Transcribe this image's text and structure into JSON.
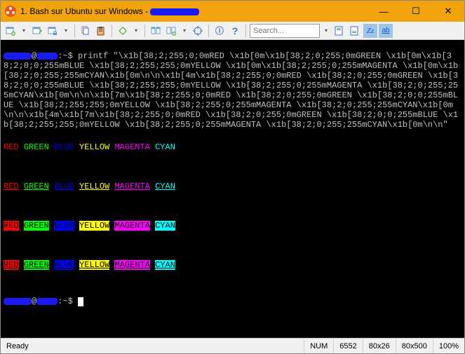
{
  "titlebar": {
    "title_prefix": "1. Bash sur Ubuntu sur Windows - "
  },
  "window_controls": {
    "minimize": "—",
    "maximize": "☐",
    "close": "✕"
  },
  "toolbar": {
    "search_placeholder": "Search..."
  },
  "icons": {
    "info": "ⓘ",
    "help": "?",
    "zz": "Zz",
    "ab": "ab"
  },
  "terminal": {
    "prompt_sep": ":~$ ",
    "command": "printf \"\\x1b[38;2;255;0;0mRED \\x1b[0m\\x1b[38;2;0;255;0mGREEN \\x1b[0m\\x1b[38;2;0;0;255mBLUE \\x1b[38;2;255;255;0mYELLOW \\x1b[0m\\x1b[38;2;255;0;255mMAGENTA \\x1b[0m\\x1b[38;2;0;255;255mCYAN\\x1b[0m\\n\\n\\x1b[4m\\x1b[38;2;255;0;0mRED \\x1b[38;2;0;255;0mGREEN \\x1b[38;2;0;0;255mBLUE \\x1b[38;2;255;255;0mYELLOW \\x1b[38;2;255;0;255mMAGENTA \\x1b[38;2;0;255;255mCYAN\\x1b[0m\\n\\n\\x1b[7m\\x1b[38;2;255;0;0mRED \\x1b[38;2;0;255;0mGREEN \\x1b[38;2;0;0;255mBLUE \\x1b[38;2;255;255;0mYELLOW \\x1b[38;2;255;0;255mMAGENTA \\x1b[38;2;0;255;255mCYAN\\x1b[0m\\n\\n\\x1b[4m\\x1b[7m\\x1b[38;2;255;0;0mRED \\x1b[38;2;0;255;0mGREEN \\x1b[38;2;0;0;255mBLUE \\x1b[38;2;255;255;0mYELLOW \\x1b[38;2;255;0;255mMAGENTA \\x1b[38;2;0;255;255mCYAN\\x1b[0m\\n\\n\"",
    "words": {
      "red": "RED",
      "green": "GREEN",
      "blue": "BLUE",
      "yellow": "YELLOW",
      "magenta": "MAGENTA",
      "cyan": "CYAN"
    }
  },
  "statusbar": {
    "ready": "Ready",
    "num": "NUM",
    "pid": "6552",
    "winsize": "80x26",
    "bufsize": "80x500",
    "zoom": "100%"
  }
}
